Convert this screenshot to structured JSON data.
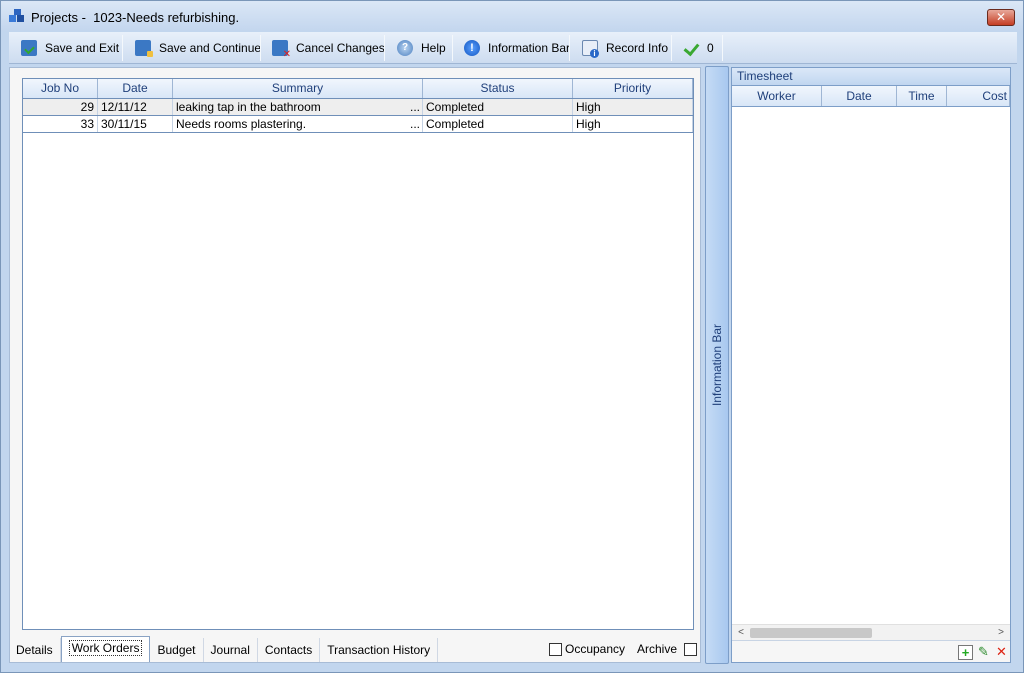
{
  "window": {
    "title": "Projects -  1023-Needs refurbishing.",
    "close_label": "✕"
  },
  "toolbar": {
    "save_exit": "Save and Exit",
    "save_continue": "Save and Continue",
    "cancel_changes": "Cancel Changes",
    "help": "Help",
    "help_glyph": "?",
    "information_bar": "Information Bar",
    "info_glyph": "!",
    "record_info": "Record Info",
    "check_count": "0"
  },
  "grid": {
    "columns": [
      "Job No",
      "Date",
      "Summary",
      "Status",
      "Priority"
    ],
    "rows": [
      {
        "job_no": "29",
        "date": "12/11/12",
        "summary": "leaking tap in the bathroom",
        "more": "...",
        "status": "Completed",
        "priority": "High"
      },
      {
        "job_no": "33",
        "date": "30/11/15",
        "summary": "Needs rooms plastering.",
        "more": "...",
        "status": "Completed",
        "priority": "High"
      }
    ]
  },
  "tabs": [
    "Details",
    "Work Orders",
    "Budget",
    "Journal",
    "Contacts",
    "Transaction History"
  ],
  "options": {
    "occupancy": "Occupancy",
    "archive": "Archive"
  },
  "info_bar": {
    "label": "Information Bar"
  },
  "timesheet": {
    "title": "Timesheet",
    "columns": [
      "Worker",
      "Date",
      "Time",
      "Cost"
    ],
    "scroll_left": "<",
    "scroll_right": ">",
    "add_glyph": "+",
    "edit_glyph": "✎",
    "delete_glyph": "✕"
  },
  "colors": {
    "accent": "#c2d6ee",
    "grid_border": "#6f8fb8",
    "header_text": "#1f3f7a"
  }
}
